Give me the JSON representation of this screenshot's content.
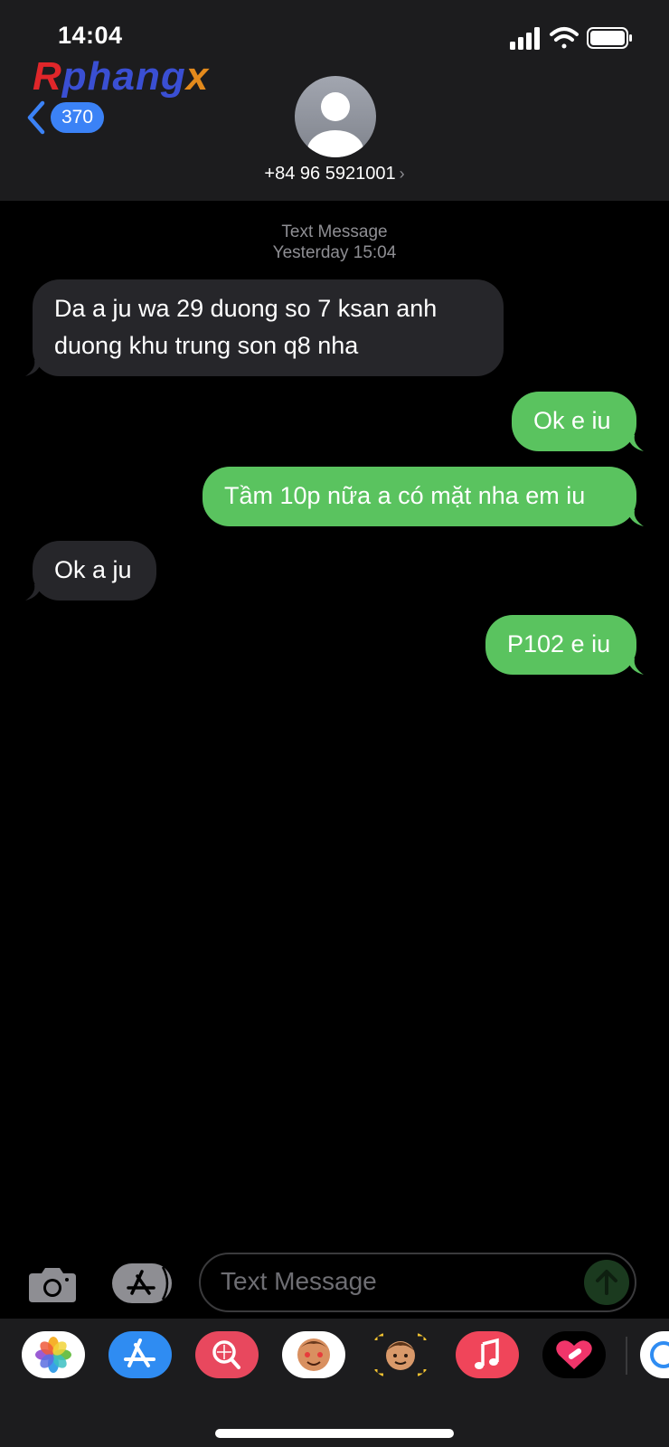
{
  "status_bar": {
    "time": "14:04"
  },
  "watermark": {
    "part1": "R",
    "part2": "phang",
    "part3": "x"
  },
  "nav": {
    "back_count": "370",
    "contact_name": "+84 96 5921001",
    "chevron": "›"
  },
  "conversation": {
    "service_label": "Text Message",
    "timestamp": "Yesterday 15:04",
    "messages": [
      {
        "direction": "incoming",
        "text": "Da a ju wa 29 duong so 7 ksan anh duong khu trung son q8 nha"
      },
      {
        "direction": "outgoing",
        "text": "Ok e iu"
      },
      {
        "direction": "outgoing",
        "text": "Tầm 10p nữa a có mặt nha em iu"
      },
      {
        "direction": "incoming",
        "text": "Ok a ju"
      },
      {
        "direction": "outgoing",
        "text": "P102 e iu"
      }
    ]
  },
  "composer": {
    "placeholder": "Text Message"
  },
  "colors": {
    "incoming_bubble": "#26262a",
    "outgoing_bubble": "#5ac35f",
    "accent": "#3b82f6"
  },
  "app_drawer": {
    "apps": [
      "photos-icon",
      "app-store-icon",
      "search-images-icon",
      "memoji-stickers-icon",
      "memoji-icon",
      "music-icon",
      "fitness-heart-icon",
      "more-app-icon"
    ]
  }
}
